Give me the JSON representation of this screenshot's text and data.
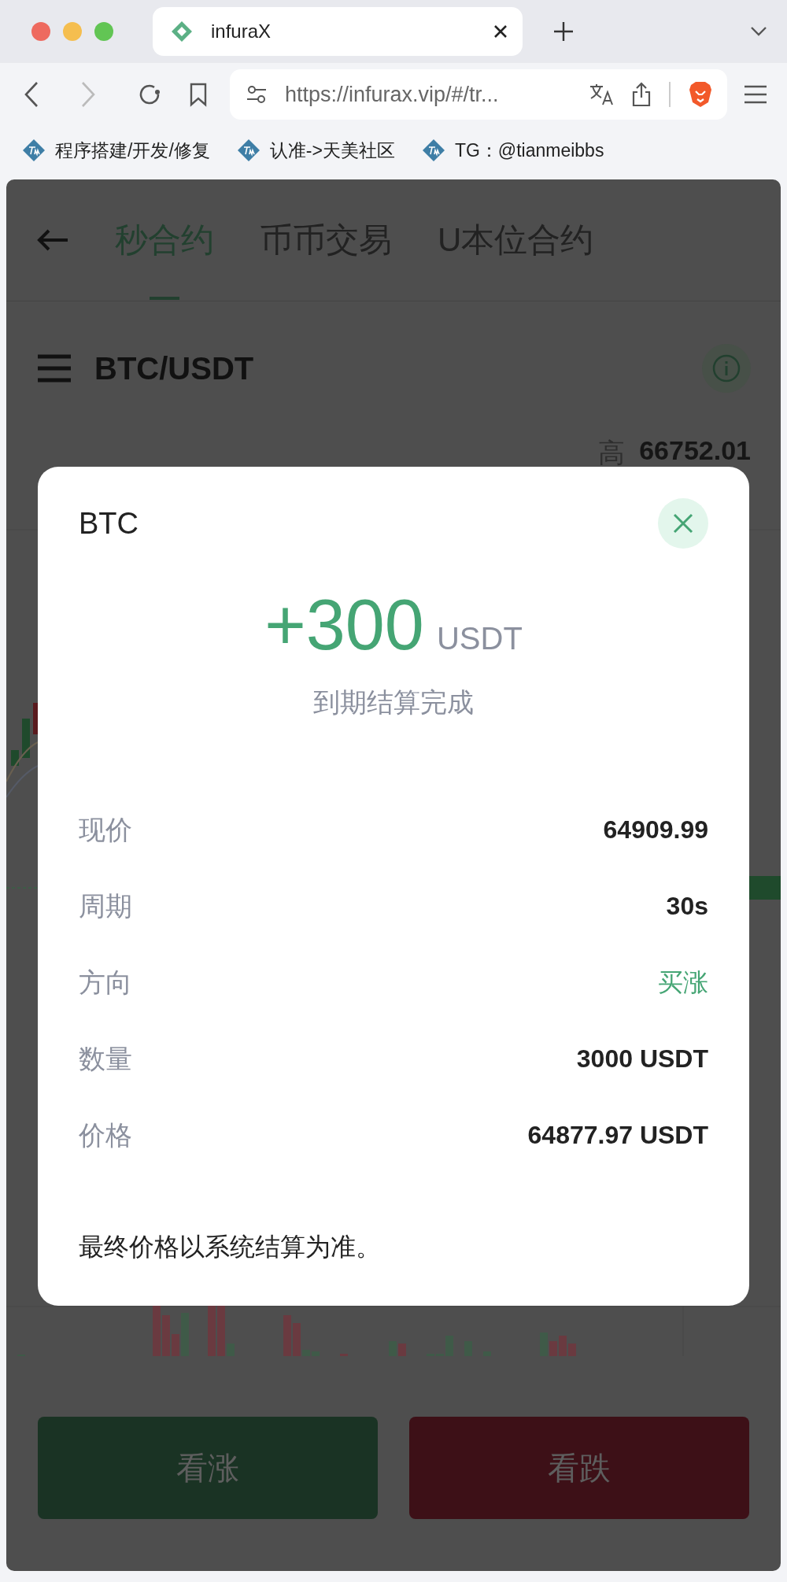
{
  "browser": {
    "tab": {
      "title": "infuraX",
      "selected": true
    },
    "url": "https://infurax.vip/#/tr...",
    "bookmarks": [
      "程序搭建/开发/修复",
      "认准->天美社区",
      "TG：@tianmeibbs"
    ]
  },
  "page": {
    "tabs": [
      {
        "label": "秒合约",
        "selected": true
      },
      {
        "label": "币币交易",
        "selected": false
      },
      {
        "label": "U本位合约",
        "selected": false
      }
    ],
    "pair": "BTC/USDT",
    "high_label": "高",
    "high_value": "66752.01",
    "buttons": [
      {
        "label": "看涨",
        "kind": "buy"
      },
      {
        "label": "看跌",
        "kind": "sell"
      }
    ]
  },
  "dialog": {
    "title": "BTC",
    "profit": "+300",
    "unit": "USDT",
    "status": "到期结算完成",
    "rows": [
      {
        "label": "现价",
        "value": "64909.99",
        "kind": "plain"
      },
      {
        "label": "周期",
        "value": "30s",
        "kind": "plain"
      },
      {
        "label": "方向",
        "value": "买涨",
        "kind": "up"
      },
      {
        "label": "数量",
        "value": "3000 USDT",
        "kind": "plain"
      },
      {
        "label": "价格",
        "value": "64877.97 USDT",
        "kind": "plain"
      }
    ],
    "note": "最终价格以系统结算为准。"
  }
}
